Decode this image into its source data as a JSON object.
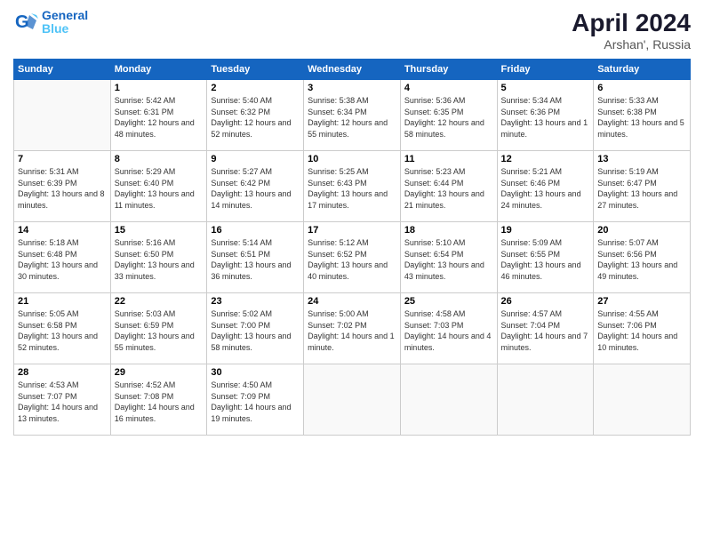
{
  "header": {
    "logo_text_1": "General",
    "logo_text_2": "Blue",
    "month": "April 2024",
    "location": "Arshan', Russia"
  },
  "days_of_week": [
    "Sunday",
    "Monday",
    "Tuesday",
    "Wednesday",
    "Thursday",
    "Friday",
    "Saturday"
  ],
  "weeks": [
    [
      {
        "day": null
      },
      {
        "day": "1",
        "sunrise": "5:42 AM",
        "sunset": "6:31 PM",
        "daylight": "12 hours and 48 minutes."
      },
      {
        "day": "2",
        "sunrise": "5:40 AM",
        "sunset": "6:32 PM",
        "daylight": "12 hours and 52 minutes."
      },
      {
        "day": "3",
        "sunrise": "5:38 AM",
        "sunset": "6:34 PM",
        "daylight": "12 hours and 55 minutes."
      },
      {
        "day": "4",
        "sunrise": "5:36 AM",
        "sunset": "6:35 PM",
        "daylight": "12 hours and 58 minutes."
      },
      {
        "day": "5",
        "sunrise": "5:34 AM",
        "sunset": "6:36 PM",
        "daylight": "13 hours and 1 minute."
      },
      {
        "day": "6",
        "sunrise": "5:33 AM",
        "sunset": "6:38 PM",
        "daylight": "13 hours and 5 minutes."
      }
    ],
    [
      {
        "day": "7",
        "sunrise": "5:31 AM",
        "sunset": "6:39 PM",
        "daylight": "13 hours and 8 minutes."
      },
      {
        "day": "8",
        "sunrise": "5:29 AM",
        "sunset": "6:40 PM",
        "daylight": "13 hours and 11 minutes."
      },
      {
        "day": "9",
        "sunrise": "5:27 AM",
        "sunset": "6:42 PM",
        "daylight": "13 hours and 14 minutes."
      },
      {
        "day": "10",
        "sunrise": "5:25 AM",
        "sunset": "6:43 PM",
        "daylight": "13 hours and 17 minutes."
      },
      {
        "day": "11",
        "sunrise": "5:23 AM",
        "sunset": "6:44 PM",
        "daylight": "13 hours and 21 minutes."
      },
      {
        "day": "12",
        "sunrise": "5:21 AM",
        "sunset": "6:46 PM",
        "daylight": "13 hours and 24 minutes."
      },
      {
        "day": "13",
        "sunrise": "5:19 AM",
        "sunset": "6:47 PM",
        "daylight": "13 hours and 27 minutes."
      }
    ],
    [
      {
        "day": "14",
        "sunrise": "5:18 AM",
        "sunset": "6:48 PM",
        "daylight": "13 hours and 30 minutes."
      },
      {
        "day": "15",
        "sunrise": "5:16 AM",
        "sunset": "6:50 PM",
        "daylight": "13 hours and 33 minutes."
      },
      {
        "day": "16",
        "sunrise": "5:14 AM",
        "sunset": "6:51 PM",
        "daylight": "13 hours and 36 minutes."
      },
      {
        "day": "17",
        "sunrise": "5:12 AM",
        "sunset": "6:52 PM",
        "daylight": "13 hours and 40 minutes."
      },
      {
        "day": "18",
        "sunrise": "5:10 AM",
        "sunset": "6:54 PM",
        "daylight": "13 hours and 43 minutes."
      },
      {
        "day": "19",
        "sunrise": "5:09 AM",
        "sunset": "6:55 PM",
        "daylight": "13 hours and 46 minutes."
      },
      {
        "day": "20",
        "sunrise": "5:07 AM",
        "sunset": "6:56 PM",
        "daylight": "13 hours and 49 minutes."
      }
    ],
    [
      {
        "day": "21",
        "sunrise": "5:05 AM",
        "sunset": "6:58 PM",
        "daylight": "13 hours and 52 minutes."
      },
      {
        "day": "22",
        "sunrise": "5:03 AM",
        "sunset": "6:59 PM",
        "daylight": "13 hours and 55 minutes."
      },
      {
        "day": "23",
        "sunrise": "5:02 AM",
        "sunset": "7:00 PM",
        "daylight": "13 hours and 58 minutes."
      },
      {
        "day": "24",
        "sunrise": "5:00 AM",
        "sunset": "7:02 PM",
        "daylight": "14 hours and 1 minute."
      },
      {
        "day": "25",
        "sunrise": "4:58 AM",
        "sunset": "7:03 PM",
        "daylight": "14 hours and 4 minutes."
      },
      {
        "day": "26",
        "sunrise": "4:57 AM",
        "sunset": "7:04 PM",
        "daylight": "14 hours and 7 minutes."
      },
      {
        "day": "27",
        "sunrise": "4:55 AM",
        "sunset": "7:06 PM",
        "daylight": "14 hours and 10 minutes."
      }
    ],
    [
      {
        "day": "28",
        "sunrise": "4:53 AM",
        "sunset": "7:07 PM",
        "daylight": "14 hours and 13 minutes."
      },
      {
        "day": "29",
        "sunrise": "4:52 AM",
        "sunset": "7:08 PM",
        "daylight": "14 hours and 16 minutes."
      },
      {
        "day": "30",
        "sunrise": "4:50 AM",
        "sunset": "7:09 PM",
        "daylight": "14 hours and 19 minutes."
      },
      {
        "day": null
      },
      {
        "day": null
      },
      {
        "day": null
      },
      {
        "day": null
      }
    ]
  ],
  "labels": {
    "sunrise": "Sunrise:",
    "sunset": "Sunset:",
    "daylight": "Daylight:"
  }
}
